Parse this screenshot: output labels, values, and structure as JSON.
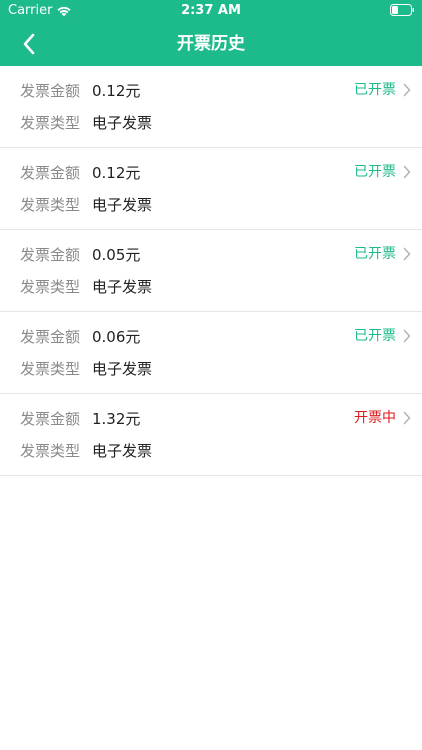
{
  "status_bar": {
    "carrier": "Carrier",
    "time": "2:37 AM"
  },
  "nav": {
    "title": "开票历史"
  },
  "labels": {
    "amount": "发票金额",
    "type": "发票类型"
  },
  "colors": {
    "header_bg": "#1dba8b",
    "status_done": "#1dba8b",
    "status_pending": "#e0191e"
  },
  "invoices": [
    {
      "amount": "0.12元",
      "type": "电子发票",
      "status": "已开票"
    },
    {
      "amount": "0.12元",
      "type": "电子发票",
      "status": "已开票"
    },
    {
      "amount": "0.05元",
      "type": "电子发票",
      "status": "已开票"
    },
    {
      "amount": "0.06元",
      "type": "电子发票",
      "status": "已开票"
    },
    {
      "amount": "1.32元",
      "type": "电子发票",
      "status": "开票中"
    }
  ]
}
